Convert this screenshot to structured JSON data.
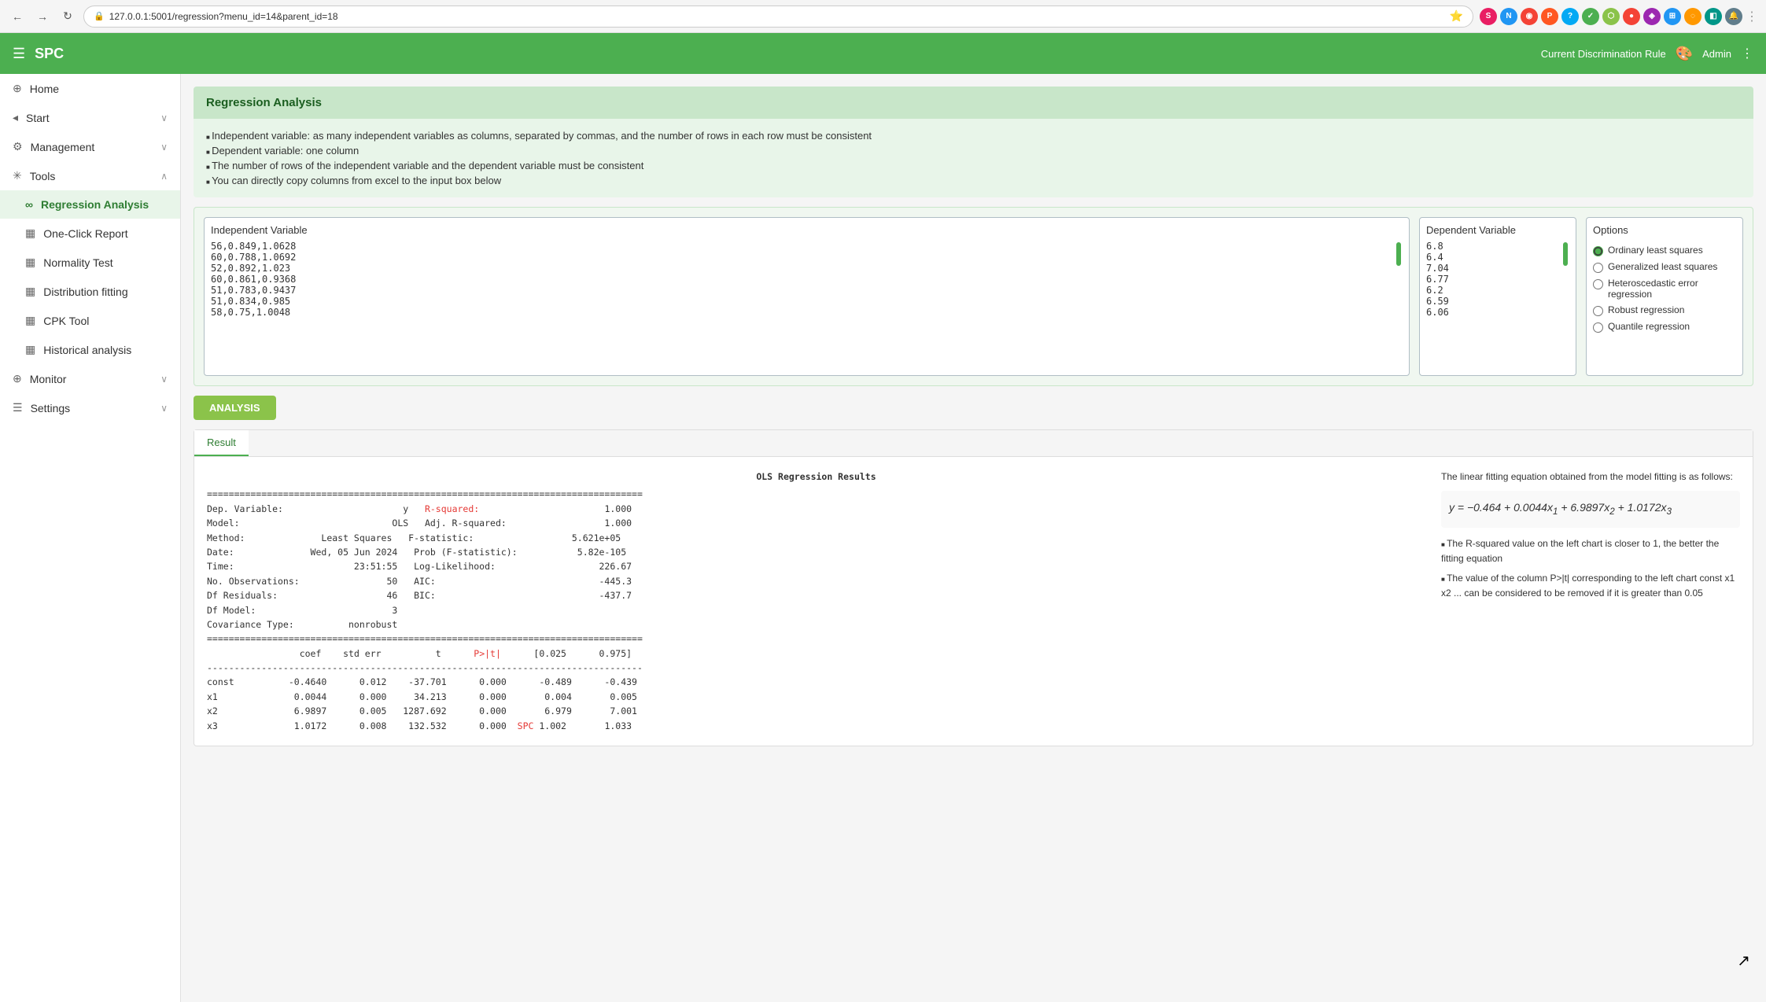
{
  "browser": {
    "url": "127.0.0.1:5001/regression?menu_id=14&parent_id=18",
    "back_icon": "←",
    "forward_icon": "→",
    "refresh_icon": "↻"
  },
  "topnav": {
    "title": "SPC",
    "hamburger": "☰",
    "right_link": "Current Discrimination Rule",
    "admin": "Admin"
  },
  "sidebar": {
    "items": [
      {
        "id": "home",
        "label": "Home",
        "icon": "⊕",
        "indent": false
      },
      {
        "id": "start",
        "label": "Start",
        "icon": "◂",
        "chevron": "∨",
        "indent": false
      },
      {
        "id": "management",
        "label": "Management",
        "icon": "⚙",
        "chevron": "∨",
        "indent": false
      },
      {
        "id": "tools",
        "label": "Tools",
        "icon": "✳",
        "chevron": "∧",
        "indent": false
      },
      {
        "id": "regression",
        "label": "Regression Analysis",
        "icon": "∞",
        "indent": true,
        "active": true
      },
      {
        "id": "oneclick",
        "label": "One-Click Report",
        "icon": "▦",
        "indent": true
      },
      {
        "id": "normality",
        "label": "Normality Test",
        "icon": "▦",
        "indent": true
      },
      {
        "id": "distribution",
        "label": "Distribution fitting",
        "icon": "▦",
        "indent": true
      },
      {
        "id": "cpk",
        "label": "CPK Tool",
        "icon": "▦",
        "indent": true
      },
      {
        "id": "historical",
        "label": "Historical analysis",
        "icon": "▦",
        "indent": true
      },
      {
        "id": "monitor",
        "label": "Monitor",
        "icon": "⊕",
        "chevron": "∨",
        "indent": false
      },
      {
        "id": "settings",
        "label": "Settings",
        "icon": "☰",
        "chevron": "∨",
        "indent": false
      }
    ]
  },
  "page": {
    "title": "Regression Analysis",
    "bullets": [
      "Independent variable: as many independent variables as columns, separated by commas, and the number of rows in each row must be consistent",
      "Dependent variable: one column",
      "The number of rows of the independent variable and the dependent variable must be consistent",
      "You can directly copy columns from excel to the input box below"
    ],
    "independent_label": "Independent Variable",
    "independent_data": "56,0.849,1.0628\n60,0.788,1.0692\n52,0.892,1.023\n60,0.861,0.9368\n51,0.783,0.9437\n51,0.834,0.985\n58,0.75,1.0048",
    "dependent_label": "Dependent Variable",
    "dependent_data": "6.8\n6.4\n7.04\n6.77\n6.2\n6.59\n6.06",
    "options_label": "Options",
    "options": [
      {
        "id": "ols",
        "label": "Ordinary least squares",
        "selected": true
      },
      {
        "id": "gls",
        "label": "Generalized least squares",
        "selected": false
      },
      {
        "id": "heter",
        "label": "Heteroscedastic error regression",
        "selected": false
      },
      {
        "id": "robust",
        "label": "Robust regression",
        "selected": false
      },
      {
        "id": "quantile",
        "label": "Quantile regression",
        "selected": false
      }
    ],
    "analysis_btn": "ANALYSIS",
    "result_tab": "Result",
    "ols_title": "OLS Regression Results",
    "ols_table": "================================================================================\nDep. Variable:                      y   R-squared:                       1.000\nModel:                            OLS   Adj. R-squared:                  1.000\nMethod:              Least Squares   F-statistic:                  5.621e+05\nDate:              Wed, 05 Jun 2024   Prob (F-statistic):           5.82e-105\nTime:                      23:51:55   Log-Likelihood:                   226.67\nNo. Observations:                50   AIC:                              -445.3\nDf Residuals:                    46   BIC:                              -437.7\nDf Model:                         3\nCovariance Type:          nonrobust\n================================================================================\n                 coef    std err          t      P>|t|      [0.025      0.975]\n--------------------------------------------------------------------------------\nconst          -0.4640      0.012    -37.701      0.000      -0.489      -0.439\nx1              0.0044      0.000     34.213      0.000       0.004       0.005\nx2              6.9897      0.005   1287.692      0.000       6.979       7.001\nx3              1.0172      0.008    132.532      0.000  SPC 1.002       1.033",
    "equation_title": "The linear fitting equation obtained from the model fitting is as follows:",
    "equation": "y = −0.464 + 0.0044x₁ + 6.9897x₂ + 1.0172x₃",
    "notes": [
      "The R-squared value on the left chart is closer to 1, the better the fitting equation",
      "The value of the column P>|t| corresponding to the left chart const x1 x2 ... can be considered to be removed if it is greater than 0.05"
    ]
  }
}
